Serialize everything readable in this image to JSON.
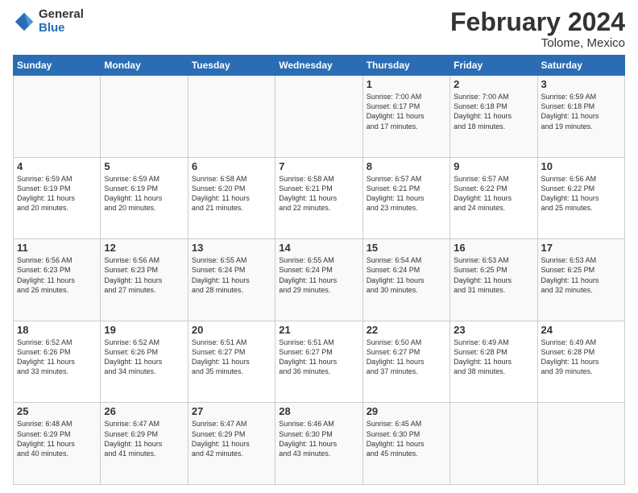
{
  "logo": {
    "general": "General",
    "blue": "Blue"
  },
  "header": {
    "month": "February 2024",
    "location": "Tolome, Mexico"
  },
  "days_of_week": [
    "Sunday",
    "Monday",
    "Tuesday",
    "Wednesday",
    "Thursday",
    "Friday",
    "Saturday"
  ],
  "weeks": [
    [
      {
        "day": "",
        "info": ""
      },
      {
        "day": "",
        "info": ""
      },
      {
        "day": "",
        "info": ""
      },
      {
        "day": "",
        "info": ""
      },
      {
        "day": "1",
        "info": "Sunrise: 7:00 AM\nSunset: 6:17 PM\nDaylight: 11 hours\nand 17 minutes."
      },
      {
        "day": "2",
        "info": "Sunrise: 7:00 AM\nSunset: 6:18 PM\nDaylight: 11 hours\nand 18 minutes."
      },
      {
        "day": "3",
        "info": "Sunrise: 6:59 AM\nSunset: 6:18 PM\nDaylight: 11 hours\nand 19 minutes."
      }
    ],
    [
      {
        "day": "4",
        "info": "Sunrise: 6:59 AM\nSunset: 6:19 PM\nDaylight: 11 hours\nand 20 minutes."
      },
      {
        "day": "5",
        "info": "Sunrise: 6:59 AM\nSunset: 6:19 PM\nDaylight: 11 hours\nand 20 minutes."
      },
      {
        "day": "6",
        "info": "Sunrise: 6:58 AM\nSunset: 6:20 PM\nDaylight: 11 hours\nand 21 minutes."
      },
      {
        "day": "7",
        "info": "Sunrise: 6:58 AM\nSunset: 6:21 PM\nDaylight: 11 hours\nand 22 minutes."
      },
      {
        "day": "8",
        "info": "Sunrise: 6:57 AM\nSunset: 6:21 PM\nDaylight: 11 hours\nand 23 minutes."
      },
      {
        "day": "9",
        "info": "Sunrise: 6:57 AM\nSunset: 6:22 PM\nDaylight: 11 hours\nand 24 minutes."
      },
      {
        "day": "10",
        "info": "Sunrise: 6:56 AM\nSunset: 6:22 PM\nDaylight: 11 hours\nand 25 minutes."
      }
    ],
    [
      {
        "day": "11",
        "info": "Sunrise: 6:56 AM\nSunset: 6:23 PM\nDaylight: 11 hours\nand 26 minutes."
      },
      {
        "day": "12",
        "info": "Sunrise: 6:56 AM\nSunset: 6:23 PM\nDaylight: 11 hours\nand 27 minutes."
      },
      {
        "day": "13",
        "info": "Sunrise: 6:55 AM\nSunset: 6:24 PM\nDaylight: 11 hours\nand 28 minutes."
      },
      {
        "day": "14",
        "info": "Sunrise: 6:55 AM\nSunset: 6:24 PM\nDaylight: 11 hours\nand 29 minutes."
      },
      {
        "day": "15",
        "info": "Sunrise: 6:54 AM\nSunset: 6:24 PM\nDaylight: 11 hours\nand 30 minutes."
      },
      {
        "day": "16",
        "info": "Sunrise: 6:53 AM\nSunset: 6:25 PM\nDaylight: 11 hours\nand 31 minutes."
      },
      {
        "day": "17",
        "info": "Sunrise: 6:53 AM\nSunset: 6:25 PM\nDaylight: 11 hours\nand 32 minutes."
      }
    ],
    [
      {
        "day": "18",
        "info": "Sunrise: 6:52 AM\nSunset: 6:26 PM\nDaylight: 11 hours\nand 33 minutes."
      },
      {
        "day": "19",
        "info": "Sunrise: 6:52 AM\nSunset: 6:26 PM\nDaylight: 11 hours\nand 34 minutes."
      },
      {
        "day": "20",
        "info": "Sunrise: 6:51 AM\nSunset: 6:27 PM\nDaylight: 11 hours\nand 35 minutes."
      },
      {
        "day": "21",
        "info": "Sunrise: 6:51 AM\nSunset: 6:27 PM\nDaylight: 11 hours\nand 36 minutes."
      },
      {
        "day": "22",
        "info": "Sunrise: 6:50 AM\nSunset: 6:27 PM\nDaylight: 11 hours\nand 37 minutes."
      },
      {
        "day": "23",
        "info": "Sunrise: 6:49 AM\nSunset: 6:28 PM\nDaylight: 11 hours\nand 38 minutes."
      },
      {
        "day": "24",
        "info": "Sunrise: 6:49 AM\nSunset: 6:28 PM\nDaylight: 11 hours\nand 39 minutes."
      }
    ],
    [
      {
        "day": "25",
        "info": "Sunrise: 6:48 AM\nSunset: 6:29 PM\nDaylight: 11 hours\nand 40 minutes."
      },
      {
        "day": "26",
        "info": "Sunrise: 6:47 AM\nSunset: 6:29 PM\nDaylight: 11 hours\nand 41 minutes."
      },
      {
        "day": "27",
        "info": "Sunrise: 6:47 AM\nSunset: 6:29 PM\nDaylight: 11 hours\nand 42 minutes."
      },
      {
        "day": "28",
        "info": "Sunrise: 6:46 AM\nSunset: 6:30 PM\nDaylight: 11 hours\nand 43 minutes."
      },
      {
        "day": "29",
        "info": "Sunrise: 6:45 AM\nSunset: 6:30 PM\nDaylight: 11 hours\nand 45 minutes."
      },
      {
        "day": "",
        "info": ""
      },
      {
        "day": "",
        "info": ""
      }
    ]
  ]
}
